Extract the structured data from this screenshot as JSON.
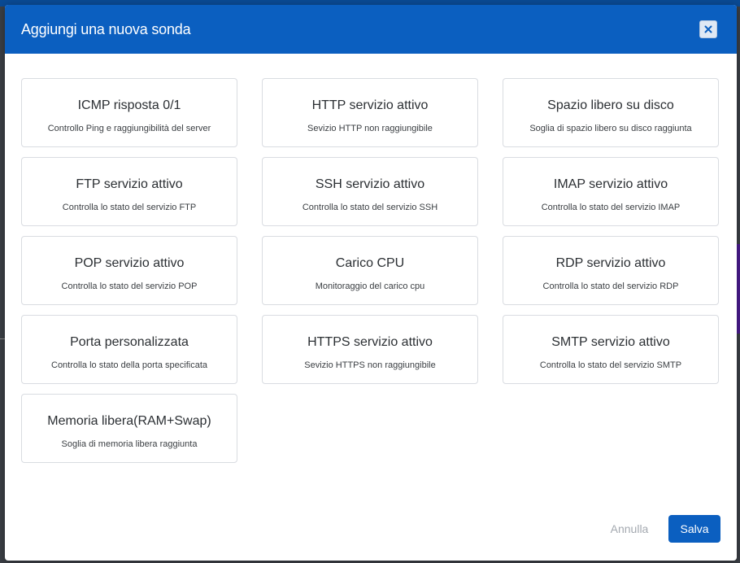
{
  "modal": {
    "title": "Aggiungi una nuova sonda",
    "close_icon": "close-icon"
  },
  "probes": [
    {
      "title": "ICMP risposta 0/1",
      "desc": "Controllo Ping e raggiungibilità del server"
    },
    {
      "title": "HTTP servizio attivo",
      "desc": "Sevizio HTTP non raggiungibile"
    },
    {
      "title": "Spazio libero su disco",
      "desc": "Soglia di spazio libero su disco raggiunta"
    },
    {
      "title": "FTP servizio attivo",
      "desc": "Controlla lo stato del servizio FTP"
    },
    {
      "title": "SSH servizio attivo",
      "desc": "Controlla lo stato del servizio SSH"
    },
    {
      "title": "IMAP servizio attivo",
      "desc": "Controlla lo stato del servizio IMAP"
    },
    {
      "title": "POP servizio attivo",
      "desc": "Controlla lo stato del servizio POP"
    },
    {
      "title": "Carico CPU",
      "desc": "Monitoraggio del carico cpu"
    },
    {
      "title": "RDP servizio attivo",
      "desc": "Controlla lo stato del servizio RDP"
    },
    {
      "title": "Porta personalizzata",
      "desc": "Controlla lo stato della porta specificata"
    },
    {
      "title": "HTTPS servizio attivo",
      "desc": "Sevizio HTTPS non raggiungibile"
    },
    {
      "title": "SMTP servizio attivo",
      "desc": "Controlla lo stato del servizio SMTP"
    },
    {
      "title": "Memoria libera(RAM+Swap)",
      "desc": "Soglia di memoria libera raggiunta"
    }
  ],
  "footer": {
    "cancel_label": "Annulla",
    "save_label": "Salva"
  },
  "colors": {
    "header": "#0b5fc0",
    "primary_button": "#0b5fc0",
    "card_border": "#d9dce1"
  }
}
